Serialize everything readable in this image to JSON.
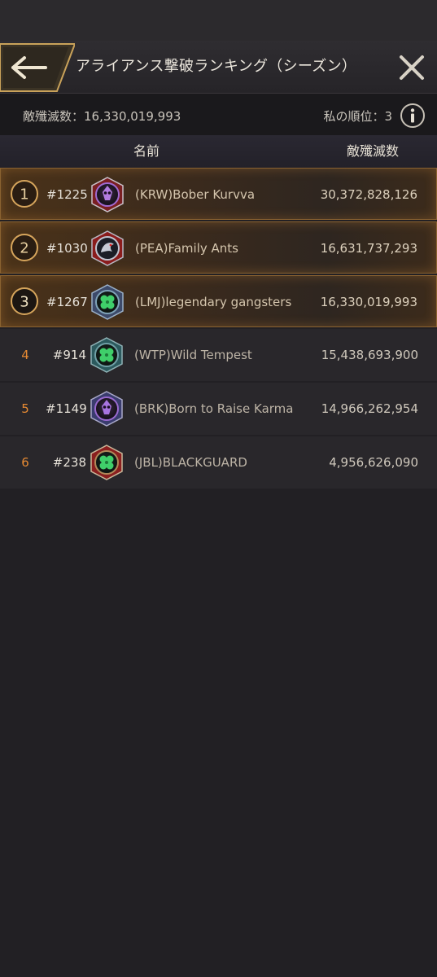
{
  "header": {
    "title": "アライアンス撃破ランキング（シーズン）",
    "back_icon": "arrow-left-icon",
    "close_icon": "close-icon"
  },
  "stats": {
    "total_kills_label": "敵殲滅数：16,330,019,993",
    "my_rank_label": "私の順位：3",
    "info_icon": "info-icon"
  },
  "columns": {
    "name": "名前",
    "kills": "敵殲滅数"
  },
  "rankings": [
    {
      "rank": "1",
      "server": "#1225",
      "alliance": "(KRW)Bober Kurvva",
      "kills": "30,372,828,126",
      "emblem": "purple-skull-emblem-icon"
    },
    {
      "rank": "2",
      "server": "#1030",
      "alliance": "(PEA)Family Ants",
      "kills": "16,631,737,293",
      "emblem": "red-dragon-emblem-icon"
    },
    {
      "rank": "3",
      "server": "#1267",
      "alliance": "(LMJ)legendary gangsters",
      "kills": "16,330,019,993",
      "emblem": "clover-emblem-icon"
    },
    {
      "rank": "4",
      "server": "#914",
      "alliance": "(WTP)Wild Tempest",
      "kills": "15,438,693,900",
      "emblem": "clover-emblem-icon"
    },
    {
      "rank": "5",
      "server": "#1149",
      "alliance": "(BRK)Born to Raise Karma",
      "kills": "14,966,262,954",
      "emblem": "purple-skull-emblem-icon"
    },
    {
      "rank": "6",
      "server": "#238",
      "alliance": "(JBL)BLACKGUARD",
      "kills": "4,956,626,090",
      "emblem": "clover-emblem-icon"
    }
  ],
  "colors": {
    "accent_gold": "#c8954a",
    "rank_orange": "#e68a33",
    "background": "#222024"
  }
}
